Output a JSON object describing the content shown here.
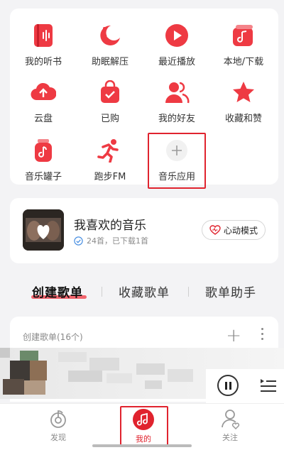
{
  "grid": {
    "items": [
      {
        "label": "我的听书",
        "icon": "book-audio-icon"
      },
      {
        "label": "助眠解压",
        "icon": "moon-icon"
      },
      {
        "label": "最近播放",
        "icon": "play-circle-icon"
      },
      {
        "label": "本地/下载",
        "icon": "music-note-icon"
      },
      {
        "label": "云盘",
        "icon": "cloud-upload-icon"
      },
      {
        "label": "已购",
        "icon": "shopping-bag-icon"
      },
      {
        "label": "我的好友",
        "icon": "friends-icon"
      },
      {
        "label": "收藏和赞",
        "icon": "star-icon"
      },
      {
        "label": "音乐罐子",
        "icon": "music-jar-icon"
      },
      {
        "label": "跑步FM",
        "icon": "running-icon"
      },
      {
        "label": "音乐应用",
        "icon": "plus-icon"
      }
    ]
  },
  "favorite": {
    "title": "我喜欢的音乐",
    "subtitle": "24首，已下载1首",
    "heart_mode_label": "心动模式"
  },
  "tabs": [
    {
      "label": "创建歌单",
      "active": true
    },
    {
      "label": "收藏歌单",
      "active": false
    },
    {
      "label": "歌单助手",
      "active": false
    }
  ],
  "playlists": {
    "header": "创建歌单(16个)",
    "add_label": "+"
  },
  "bottom_nav": [
    {
      "label": "发现",
      "icon": "discover-icon",
      "active": false
    },
    {
      "label": "我的",
      "icon": "music-note-icon",
      "active": true
    },
    {
      "label": "关注",
      "icon": "follow-icon",
      "active": false
    }
  ],
  "colors": {
    "accent": "#e0232e",
    "icon_red": "#ee3a43"
  }
}
